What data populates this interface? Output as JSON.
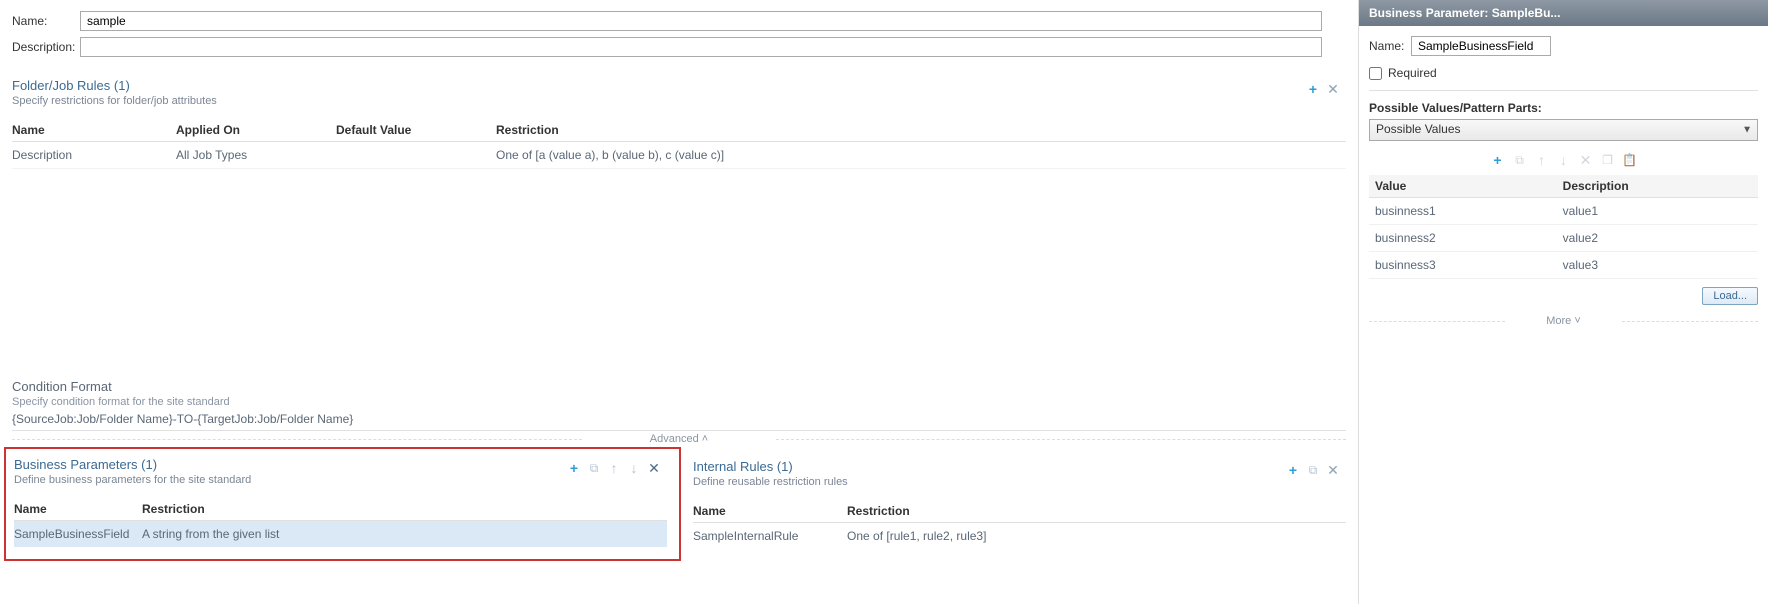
{
  "header": {
    "name_label": "Name:",
    "name_value": "sample",
    "desc_label": "Description:",
    "desc_value": ""
  },
  "rules_section": {
    "title": "Folder/Job Rules (1)",
    "subtitle": "Specify restrictions for folder/job attributes",
    "cols": {
      "name": "Name",
      "applied": "Applied On",
      "default": "Default Value",
      "restriction": "Restriction"
    },
    "rows": [
      {
        "name": "Description",
        "applied": "All Job Types",
        "default": "",
        "restriction": "One of [a (value a), b (value b), c (value c)]"
      }
    ]
  },
  "condition_format": {
    "title": "Condition Format",
    "subtitle": "Specify condition format for the site standard",
    "value": "{SourceJob:Job/Folder Name}-TO-{TargetJob:Job/Folder Name}"
  },
  "advanced_label": "Advanced",
  "business_params": {
    "title": "Business Parameters (1)",
    "subtitle": "Define business parameters for the site standard",
    "cols": {
      "name": "Name",
      "restriction": "Restriction"
    },
    "rows": [
      {
        "name": "SampleBusinessField",
        "restriction": "A string from the given list"
      }
    ]
  },
  "internal_rules": {
    "title": "Internal Rules (1)",
    "subtitle": "Define reusable restriction rules",
    "cols": {
      "name": "Name",
      "restriction": "Restriction"
    },
    "rows": [
      {
        "name": "SampleInternalRule",
        "restriction": "One of [rule1, rule2, rule3]"
      }
    ]
  },
  "right_panel": {
    "header": "Business Parameter: SampleBu...",
    "name_label": "Name:",
    "name_value": "SampleBusinessField",
    "required_label": "Required",
    "required_checked": false,
    "pvp_label": "Possible Values/Pattern Parts:",
    "pvp_select": "Possible Values",
    "cols": {
      "value": "Value",
      "description": "Description"
    },
    "rows": [
      {
        "value": "businness1",
        "description": "value1"
      },
      {
        "value": "businness2",
        "description": "value2"
      },
      {
        "value": "businness3",
        "description": "value3"
      }
    ],
    "load_btn": "Load...",
    "more_label": "More"
  }
}
